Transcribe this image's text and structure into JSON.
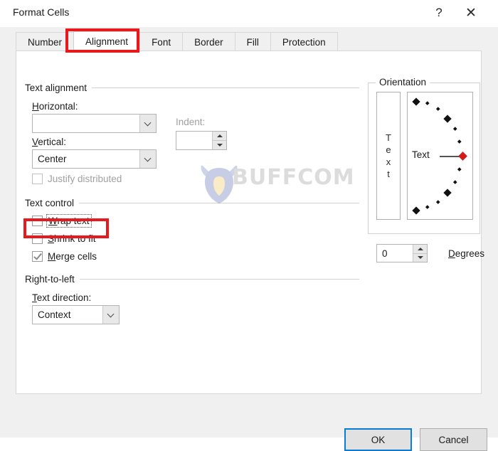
{
  "window": {
    "title": "Format Cells",
    "help_icon": "question-mark-icon",
    "help_glyph": "?",
    "close_icon": "close-icon",
    "close_glyph": "✕"
  },
  "tabs": [
    {
      "label": "Number",
      "active": false
    },
    {
      "label": "Alignment",
      "active": true
    },
    {
      "label": "Font",
      "active": false
    },
    {
      "label": "Border",
      "active": false
    },
    {
      "label": "Fill",
      "active": false
    },
    {
      "label": "Protection",
      "active": false
    }
  ],
  "text_alignment": {
    "group_label": "Text alignment",
    "horizontal_label": "Horizontal:",
    "horizontal_value": "",
    "vertical_label": "Vertical:",
    "vertical_value": "Center",
    "indent_label": "Indent:",
    "indent_value": "",
    "justify_distributed_label": "Justify distributed",
    "justify_distributed_checked": false,
    "justify_distributed_disabled": true
  },
  "text_control": {
    "group_label": "Text control",
    "wrap_text_label": "Wrap text",
    "wrap_text_checked": false,
    "shrink_to_fit_label": "Shrink to fit",
    "shrink_to_fit_checked": false,
    "merge_cells_label": "Merge cells",
    "merge_cells_checked": true
  },
  "right_to_left": {
    "group_label": "Right-to-left",
    "text_direction_label": "Text direction:",
    "text_direction_value": "Context"
  },
  "orientation": {
    "group_label": "Orientation",
    "sample_vertical_letters": [
      "T",
      "e",
      "x",
      "t"
    ],
    "dial_sample_label": "Text",
    "degrees_value": "0",
    "degrees_label": "Degrees"
  },
  "footer": {
    "ok_label": "OK",
    "cancel_label": "Cancel"
  },
  "watermark": {
    "text": "BUFFCOM"
  },
  "highlights": {
    "accent_color": "#e8191c",
    "focus_color": "#0a7cd4"
  }
}
